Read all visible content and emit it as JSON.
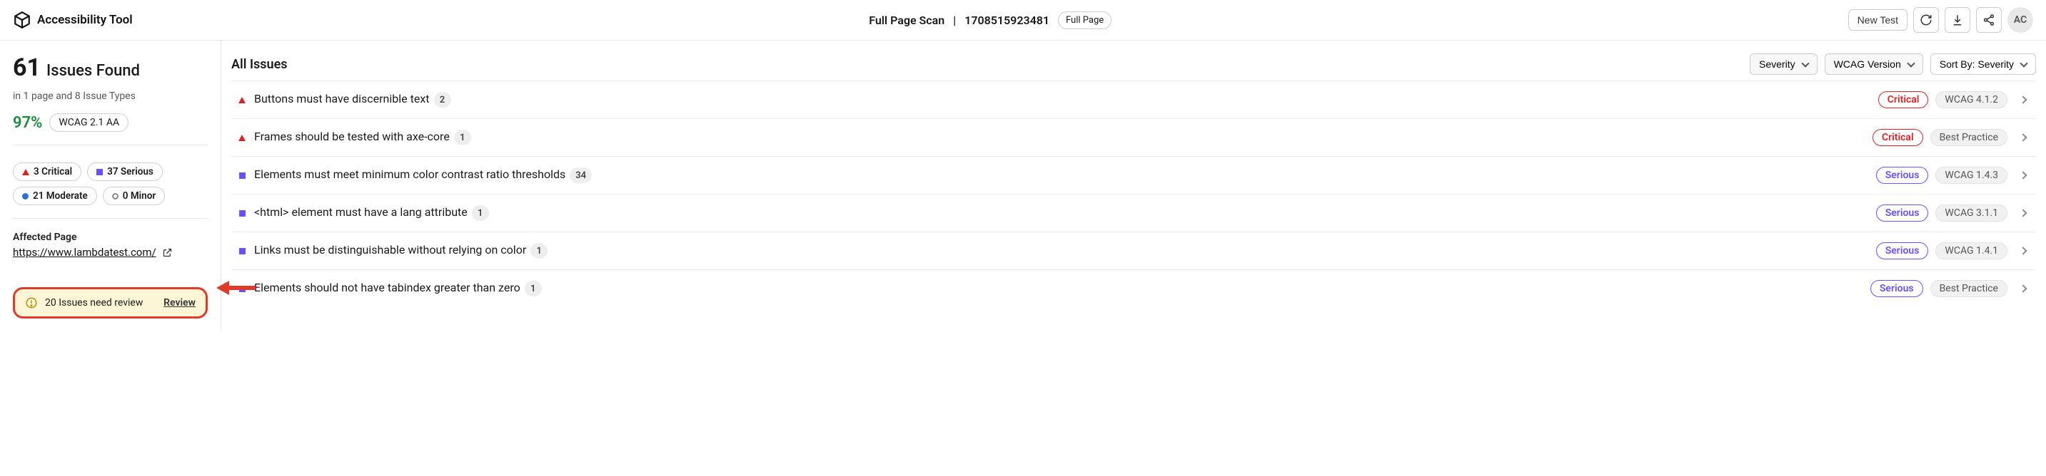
{
  "header": {
    "app_title": "Accessibility Tool",
    "scan_label": "Full Page Scan",
    "scan_id": "1708515923481",
    "full_page_pill": "Full Page",
    "new_test_label": "New Test",
    "avatar_initials": "AC"
  },
  "sidebar": {
    "issues_count": "61",
    "issues_label": "Issues Found",
    "issues_sub": "in 1 page and 8 Issue Types",
    "pass_pct": "97%",
    "wcag_pill": "WCAG 2.1 AA",
    "sev": [
      {
        "label": "3 Critical"
      },
      {
        "label": "37 Serious"
      },
      {
        "label": "21 Moderate"
      },
      {
        "label": "0 Minor"
      }
    ],
    "affected_label": "Affected Page",
    "affected_url": "https://www.lambdatest.com/",
    "review": {
      "text": "20 Issues need review",
      "action": "Review"
    }
  },
  "main": {
    "title": "All Issues",
    "filters": {
      "severity": "Severity",
      "wcag_version": "WCAG Version",
      "sort_prefix": "Sort By: ",
      "sort_value": "Severity"
    },
    "issues": [
      {
        "marker": "critical",
        "title": "Buttons must have discernible text",
        "count": "2",
        "sev": "Critical",
        "wcag": "WCAG 4.1.2"
      },
      {
        "marker": "critical",
        "title": "Frames should be tested with axe-core",
        "count": "1",
        "sev": "Critical",
        "wcag": "Best Practice"
      },
      {
        "marker": "serious",
        "title": "Elements must meet minimum color contrast ratio thresholds",
        "count": "34",
        "sev": "Serious",
        "wcag": "WCAG 1.4.3"
      },
      {
        "marker": "serious",
        "title": "<html> element must have a lang attribute",
        "count": "1",
        "sev": "Serious",
        "wcag": "WCAG 3.1.1"
      },
      {
        "marker": "serious",
        "title": "Links must be distinguishable without relying on color",
        "count": "1",
        "sev": "Serious",
        "wcag": "WCAG 1.4.1"
      },
      {
        "marker": "serious",
        "title": "Elements should not have tabindex greater than zero",
        "count": "1",
        "sev": "Serious",
        "wcag": "Best Practice"
      }
    ]
  }
}
